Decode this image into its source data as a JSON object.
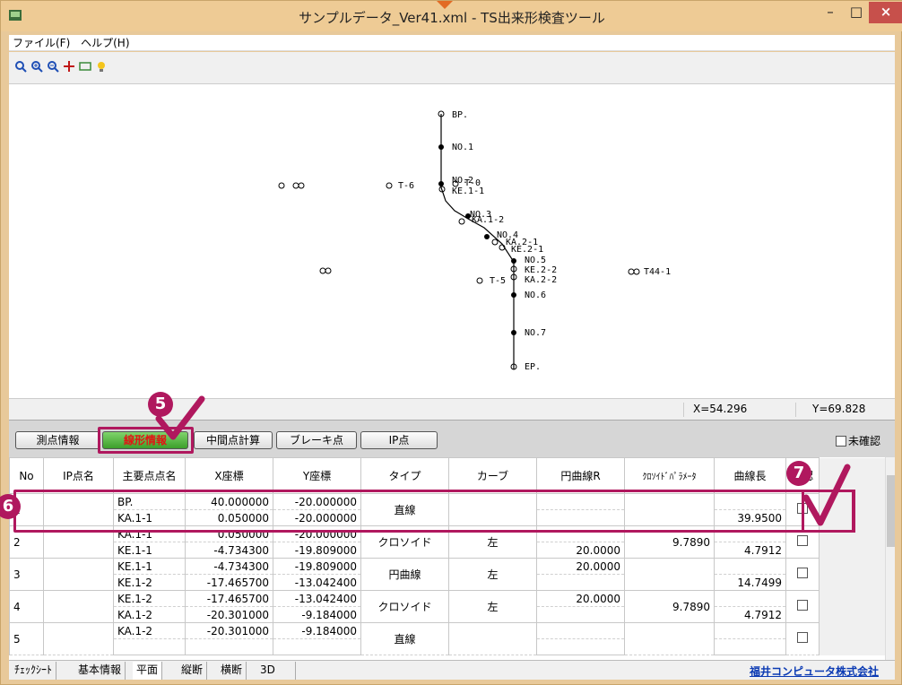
{
  "window": {
    "title": "サンプルデータ_Ver41.xml - TS出来形検査ツール",
    "minimize_glyph": "–",
    "maximize_glyph": "□",
    "close_glyph": "×"
  },
  "menu": [
    "ファイル(F)",
    "ヘルプ(H)"
  ],
  "toolbar_icons": [
    "zoom-icon",
    "zoom-in-icon",
    "zoom-out-icon",
    "pan-icon",
    "fit-icon",
    "lightbulb-icon"
  ],
  "drawing": {
    "points": [
      "BP.",
      "NO.1",
      "NO.2",
      "KE.1-1",
      "NO.3",
      "KA.1-2",
      "NO.4",
      "KA.2-1",
      "KE.2-1",
      "NO.5",
      "KE.2-2",
      "KA.2-2",
      "NO.6",
      "NO.7",
      "EP."
    ],
    "ip_labels": [
      "T-0",
      "T-6",
      "T-5",
      "T44-1"
    ]
  },
  "coords": {
    "x": "X=54.296",
    "y": "Y=69.828"
  },
  "tabs": [
    "測点情報",
    "線形情報",
    "中間点計算",
    "ブレーキ点",
    "IP点"
  ],
  "unconfirmed_label": "未確認",
  "table": {
    "headers": [
      "No",
      "IP点名",
      "主要点点名",
      "X座標",
      "Y座標",
      "タイプ",
      "カーブ",
      "円曲線R",
      "ｸﾛｿｲﾄﾞﾊﾟﾗﾒｰﾀ",
      "曲線長",
      "確認"
    ],
    "rows": [
      {
        "no": "1",
        "ip": "",
        "p1": "BP.",
        "p2": "KA.1-1",
        "x1": "40.000000",
        "x2": "0.050000",
        "y1": "-20.000000",
        "y2": "-20.000000",
        "type": "直線",
        "curve": "",
        "r1": "",
        "r2": "",
        "param": "",
        "len": "39.9500"
      },
      {
        "no": "2",
        "ip": "",
        "p1": "KA.1-1",
        "p2": "KE.1-1",
        "x1": "0.050000",
        "x2": "-4.734300",
        "y1": "-20.000000",
        "y2": "-19.809000",
        "type": "クロソイド",
        "curve": "左",
        "r1": "",
        "r2": "20.0000",
        "param": "9.7890",
        "len": "4.7912"
      },
      {
        "no": "3",
        "ip": "",
        "p1": "KE.1-1",
        "p2": "KE.1-2",
        "x1": "-4.734300",
        "x2": "-17.465700",
        "y1": "-19.809000",
        "y2": "-13.042400",
        "type": "円曲線",
        "curve": "左",
        "r1": "20.0000",
        "r2": "",
        "param": "",
        "len": "14.7499"
      },
      {
        "no": "4",
        "ip": "",
        "p1": "KE.1-2",
        "p2": "KA.1-2",
        "x1": "-17.465700",
        "x2": "-20.301000",
        "y1": "-13.042400",
        "y2": "-9.184000",
        "type": "クロソイド",
        "curve": "左",
        "r1": "20.0000",
        "r2": "",
        "param": "9.7890",
        "len": "4.7912"
      },
      {
        "no": "5",
        "ip": "",
        "p1": "KA.1-2",
        "p2": "",
        "x1": "-20.301000",
        "x2": "",
        "y1": "-9.184000",
        "y2": "",
        "type": "直線",
        "curve": "",
        "r1": "",
        "r2": "",
        "param": "",
        "len": ""
      }
    ]
  },
  "bottom_tabs": [
    "ﾁｪｯｸｼｰﾄ",
    "基本情報",
    "平面",
    "縦断",
    "横断",
    "3D"
  ],
  "company": "福井コンピュータ株式会社",
  "callouts": [
    "5",
    "6",
    "7"
  ],
  "colors": {
    "accent": "#b0185e",
    "titlebar": "#eecb95",
    "active_tab": "#3c9f2a",
    "link": "#0b3ab3"
  }
}
